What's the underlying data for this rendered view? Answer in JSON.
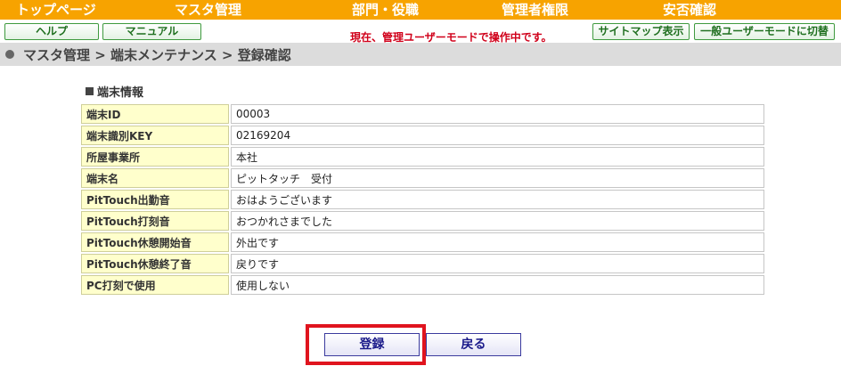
{
  "topnav": {
    "items": [
      "トップページ",
      "マスタ管理",
      "部門・役職",
      "管理者権限",
      "安否確認"
    ]
  },
  "buttons": {
    "help": "ヘルプ",
    "manual": "マニュアル",
    "sitemap": "サイトマップ表示",
    "switch_mode": "一般ユーザーモードに切替"
  },
  "mode_message": "現在、管理ユーザーモードで操作中です。",
  "breadcrumb": "マスタ管理 > 端末メンテナンス > 登録確認",
  "section_title": "端末情報",
  "table": {
    "rows": [
      {
        "label": "端末ID",
        "value": "00003"
      },
      {
        "label": "端末識別KEY",
        "value": "02169204"
      },
      {
        "label": "所屋事業所",
        "value": "本社"
      },
      {
        "label": "端末名",
        "value": "ピットタッチ　受付"
      },
      {
        "label": "PitTouch出勤音",
        "value": "おはようございます"
      },
      {
        "label": "PitTouch打刻音",
        "value": "おつかれさまでした"
      },
      {
        "label": "PitTouch休憩開始音",
        "value": "外出です"
      },
      {
        "label": "PitTouch休憩終了音",
        "value": "戻りです"
      },
      {
        "label": "PC打刻で使用",
        "value": "使用しない"
      }
    ]
  },
  "actions": {
    "register": "登録",
    "back": "戻る"
  },
  "colors": {
    "nav_bg": "#f7a300",
    "mode_message": "#d0001a",
    "label_bg": "#ffffcc",
    "highlight": "#e0141e"
  }
}
